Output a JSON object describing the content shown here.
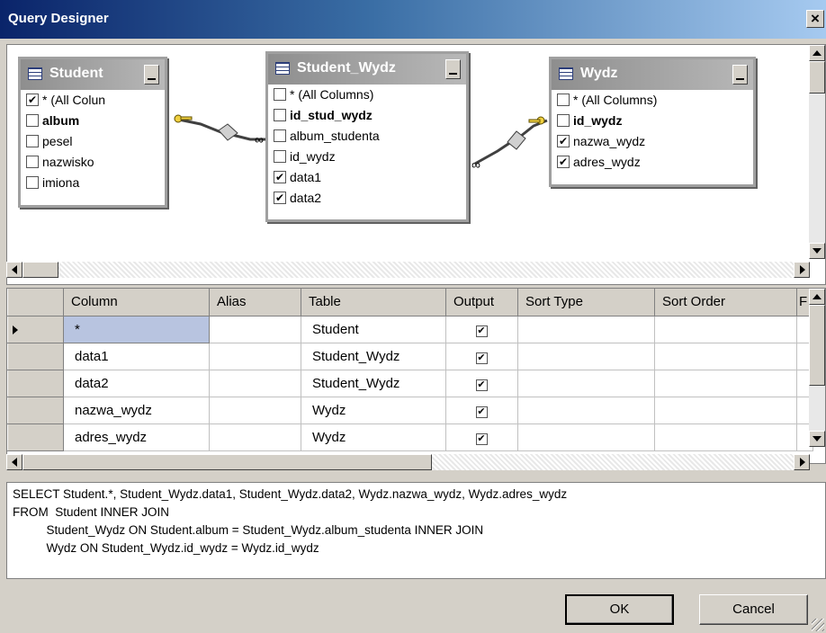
{
  "window": {
    "title": "Query Designer",
    "close_label": "×"
  },
  "diagram": {
    "tables": [
      {
        "name": "Student",
        "columns": [
          {
            "label": "* (All Colun",
            "checked": true,
            "bold": false
          },
          {
            "label": "album",
            "checked": false,
            "bold": true
          },
          {
            "label": "pesel",
            "checked": false,
            "bold": false
          },
          {
            "label": "nazwisko",
            "checked": false,
            "bold": false
          },
          {
            "label": "imiona",
            "checked": false,
            "bold": false
          }
        ]
      },
      {
        "name": "Student_Wydz",
        "columns": [
          {
            "label": "* (All Columns)",
            "checked": false,
            "bold": false
          },
          {
            "label": "id_stud_wydz",
            "checked": false,
            "bold": true
          },
          {
            "label": "album_studenta",
            "checked": false,
            "bold": false
          },
          {
            "label": "id_wydz",
            "checked": false,
            "bold": false
          },
          {
            "label": "data1",
            "checked": true,
            "bold": false
          },
          {
            "label": "data2",
            "checked": true,
            "bold": false
          }
        ]
      },
      {
        "name": "Wydz",
        "columns": [
          {
            "label": "* (All Columns)",
            "checked": false,
            "bold": false
          },
          {
            "label": "id_wydz",
            "checked": false,
            "bold": true
          },
          {
            "label": "nazwa_wydz",
            "checked": true,
            "bold": false
          },
          {
            "label": "adres_wydz",
            "checked": true,
            "bold": false
          }
        ]
      }
    ]
  },
  "grid": {
    "headers": [
      "Column",
      "Alias",
      "Table",
      "Output",
      "Sort Type",
      "Sort Order",
      "F"
    ],
    "rows": [
      {
        "column": "*",
        "alias": "",
        "table": "Student",
        "output": "☑"
      },
      {
        "column": "data1",
        "alias": "",
        "table": "Student_Wydz",
        "output": "☑"
      },
      {
        "column": "data2",
        "alias": "",
        "table": "Student_Wydz",
        "output": "☑"
      },
      {
        "column": "nazwa_wydz",
        "alias": "",
        "table": "Wydz",
        "output": "☑"
      },
      {
        "column": "adres_wydz",
        "alias": "",
        "table": "Wydz",
        "output": "☑"
      }
    ]
  },
  "sql": {
    "lines": [
      "SELECT Student.*, Student_Wydz.data1, Student_Wydz.data2, Wydz.nazwa_wydz, Wydz.adres_wydz",
      "FROM  Student INNER JOIN",
      "          Student_Wydz ON Student.album = Student_Wydz.album_studenta INNER JOIN",
      "          Wydz ON Student_Wydz.id_wydz = Wydz.id_wydz"
    ]
  },
  "buttons": {
    "ok": "OK",
    "cancel": "Cancel"
  },
  "check_mark": "✔"
}
